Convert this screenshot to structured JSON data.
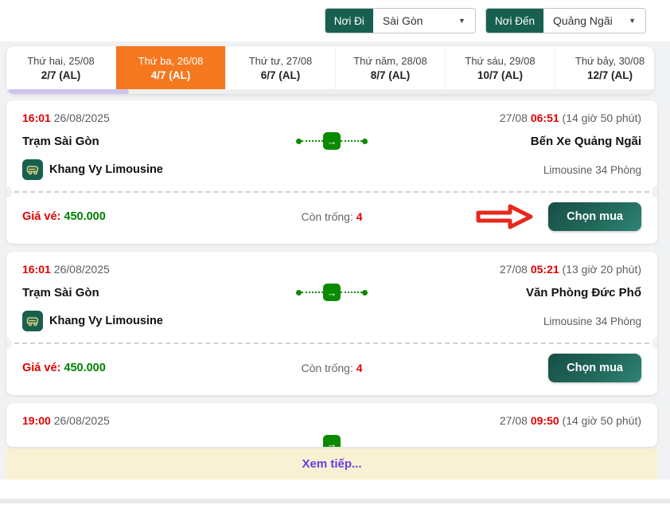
{
  "search": {
    "origin": {
      "label": "Nơi Đi",
      "value": "Sài Gòn"
    },
    "destination": {
      "label": "Nơi Đến",
      "value": "Quảng Ngãi"
    }
  },
  "date_tabs": [
    {
      "day": "Thứ hai, 25/08",
      "lunar": "2/7 (AL)"
    },
    {
      "day": "Thứ ba, 26/08",
      "lunar": "4/7 (AL)"
    },
    {
      "day": "Thứ tư, 27/08",
      "lunar": "6/7 (AL)"
    },
    {
      "day": "Thứ năm, 28/08",
      "lunar": "8/7 (AL)"
    },
    {
      "day": "Thứ sáu, 29/08",
      "lunar": "10/7 (AL)"
    },
    {
      "day": "Thứ bảy, 30/08",
      "lunar": "12/7 (AL)"
    }
  ],
  "active_tab_index": 1,
  "trips": [
    {
      "depart_time": "16:01",
      "depart_date": "26/08/2025",
      "arrive_prefix": "27/08",
      "arrive_time": "06:51",
      "duration": "(14 giờ 50 phút)",
      "from": "Trạm Sài Gòn",
      "to": "Bến Xe Quảng Ngãi",
      "operator": "Khang Vy Limousine",
      "vehicle": "Limousine 34 Phòng",
      "price_label": "Giá vé:",
      "price": "450.000",
      "seats_label": "Còn trống:",
      "seats": "4",
      "buy_label": "Chọn mua"
    },
    {
      "depart_time": "16:01",
      "depart_date": "26/08/2025",
      "arrive_prefix": "27/08",
      "arrive_time": "05:21",
      "duration": "(13 giờ 20 phút)",
      "from": "Trạm Sài Gòn",
      "to": "Văn Phòng Đức Phổ",
      "operator": "Khang Vy Limousine",
      "vehicle": "Limousine 34 Phòng",
      "price_label": "Giá vé:",
      "price": "450.000",
      "seats_label": "Còn trống:",
      "seats": "4",
      "buy_label": "Chọn mua"
    },
    {
      "depart_time": "19:00",
      "depart_date": "26/08/2025",
      "arrive_prefix": "27/08",
      "arrive_time": "09:50",
      "duration": "(14 giờ 50 phút)"
    }
  ],
  "load_more_label": "Xem tiếp...",
  "icons": {
    "chevron_down": "▼",
    "route_arrow": "→"
  },
  "colors": {
    "accent_orange": "#F5781F",
    "brand_teal": "#17604F",
    "highlight_red": "#E30000",
    "price_green": "#008000",
    "route_green": "#0B8A00",
    "link_purple": "#6A3BE8",
    "load_more_bg": "#F9F1D3",
    "scrollbar_thumb": "#CFC4EC"
  }
}
